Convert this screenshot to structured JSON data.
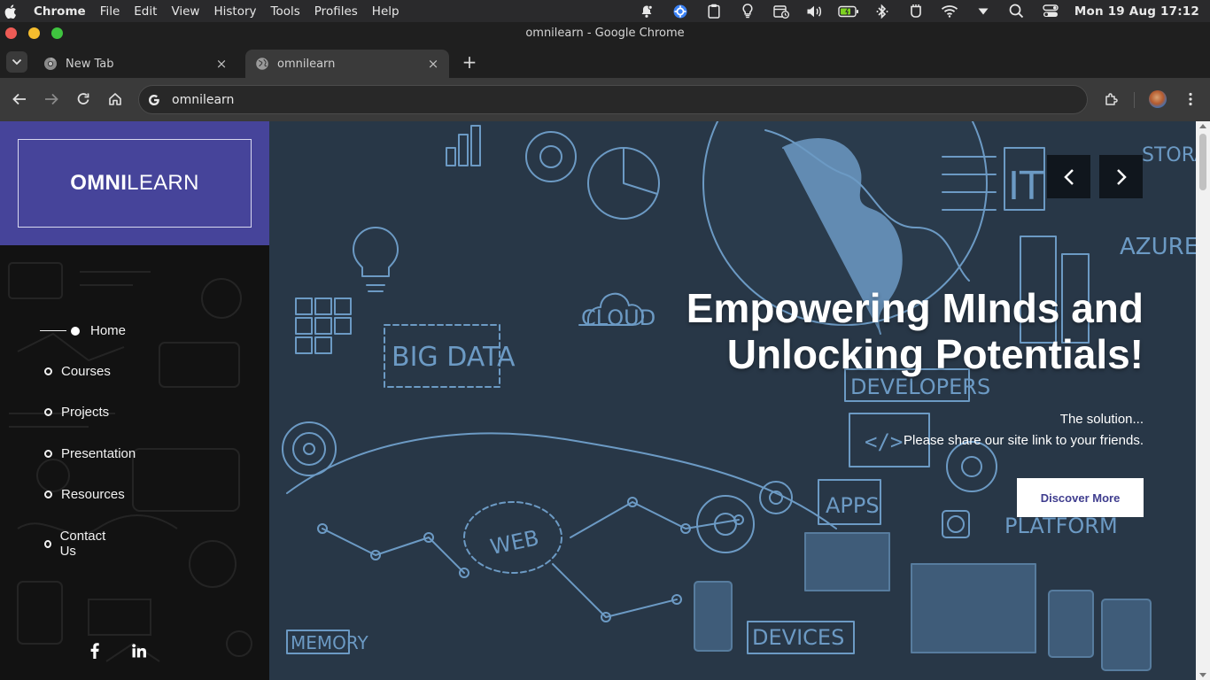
{
  "os_menu": {
    "app_name": "Chrome",
    "items": [
      "File",
      "Edit",
      "View",
      "History",
      "Tools",
      "Profiles",
      "Help"
    ],
    "clock": "Mon 19 Aug 17:12"
  },
  "window": {
    "title": "omnilearn - Google Chrome"
  },
  "tabs": [
    {
      "title": "New Tab",
      "active": false,
      "close": "×"
    },
    {
      "title": "omnilearn",
      "active": true,
      "close": "×"
    }
  ],
  "new_tab_glyph": "+",
  "omnibox": {
    "value": "omnilearn"
  },
  "site": {
    "logo_bold": "OMNI",
    "logo_light": "LEARN",
    "nav": [
      {
        "label": "Home",
        "active": true
      },
      {
        "label": "Courses",
        "active": false
      },
      {
        "label": "Projects",
        "active": false
      },
      {
        "label": "Presentation",
        "active": false
      },
      {
        "label": "Resources",
        "active": false
      },
      {
        "label": "Contact Us",
        "active": false
      }
    ],
    "social": [
      "facebook-icon",
      "linkedin-icon"
    ],
    "hero": {
      "title_line1": "Empowering MInds and",
      "title_line2": "Unlocking Potentials!",
      "sub1": "The solution...",
      "sub2": "Please share our site link to your friends.",
      "cta": "Discover More"
    },
    "colors": {
      "brand": "#46449a",
      "sidebar_bg": "#121212",
      "hero_bg": "#2a3a4a",
      "doodle": "#6c9ac4"
    }
  }
}
